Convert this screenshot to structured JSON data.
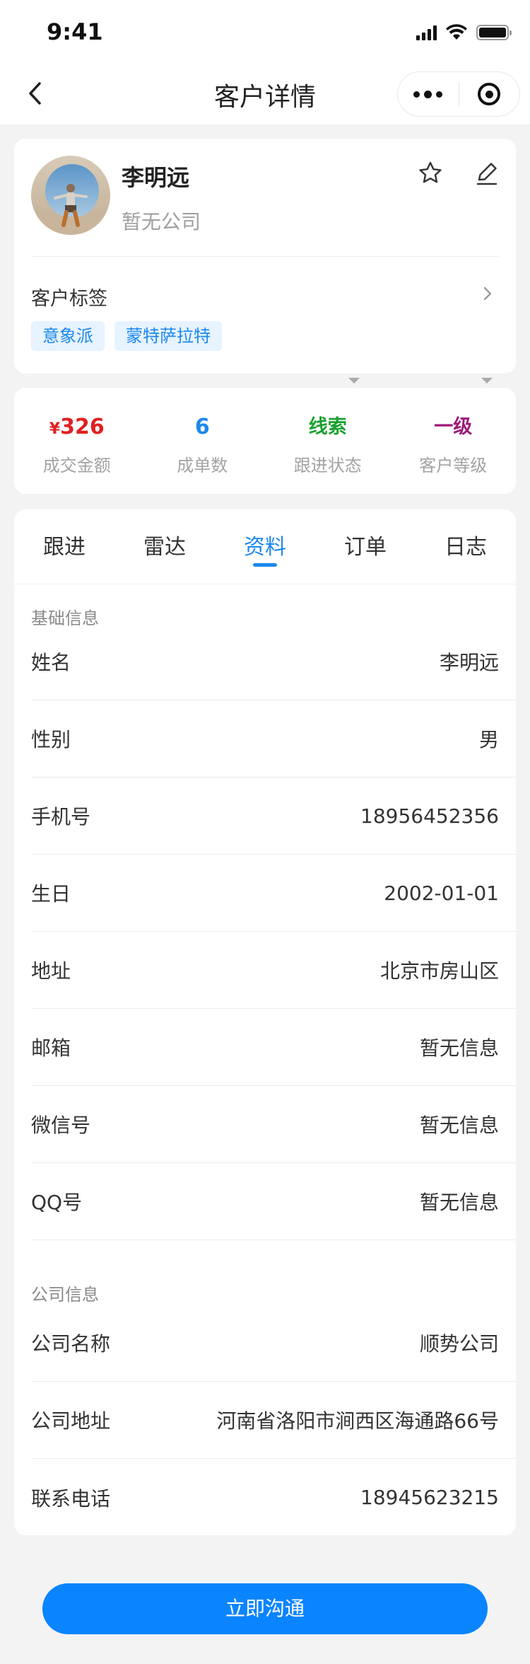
{
  "status_bar": {
    "time": "9:41"
  },
  "nav": {
    "title": "客户详情"
  },
  "profile": {
    "name": "李明远",
    "company": "暂无公司",
    "tags_label": "客户标签",
    "tags": [
      "意象派",
      "蒙特萨拉特"
    ]
  },
  "stats": [
    {
      "currency": "¥",
      "value": "326",
      "label": "成交金额",
      "color": "#e02020"
    },
    {
      "currency": "",
      "value": "6",
      "label": "成单数",
      "color": "#1c88ee"
    },
    {
      "currency": "",
      "value": "线索",
      "label": "跟进状态",
      "color": "#19a02f"
    },
    {
      "currency": "",
      "value": "一级",
      "label": "客户等级",
      "color": "#9b1b7a"
    }
  ],
  "tabs": [
    "跟进",
    "雷达",
    "资料",
    "订单",
    "日志"
  ],
  "active_tab": "资料",
  "basic_info": {
    "title": "基础信息",
    "rows": [
      {
        "label": "姓名",
        "value": "李明远"
      },
      {
        "label": "性别",
        "value": "男"
      },
      {
        "label": "手机号",
        "value": "18956452356"
      },
      {
        "label": "生日",
        "value": "2002-01-01"
      },
      {
        "label": "地址",
        "value": "北京市房山区"
      },
      {
        "label": "邮箱",
        "value": "暂无信息"
      },
      {
        "label": "微信号",
        "value": "暂无信息"
      },
      {
        "label": "QQ号",
        "value": "暂无信息"
      }
    ]
  },
  "company_info": {
    "title": "公司信息",
    "rows": [
      {
        "label": "公司名称",
        "value": "顺势公司"
      },
      {
        "label": "公司地址",
        "value": "河南省洛阳市涧西区海通路66号"
      },
      {
        "label": "联系电话",
        "value": "18945623215"
      }
    ]
  },
  "cta": {
    "label": "立即沟通"
  },
  "colors": {
    "accent": "#1c88ee",
    "button": "#0a84ff"
  }
}
